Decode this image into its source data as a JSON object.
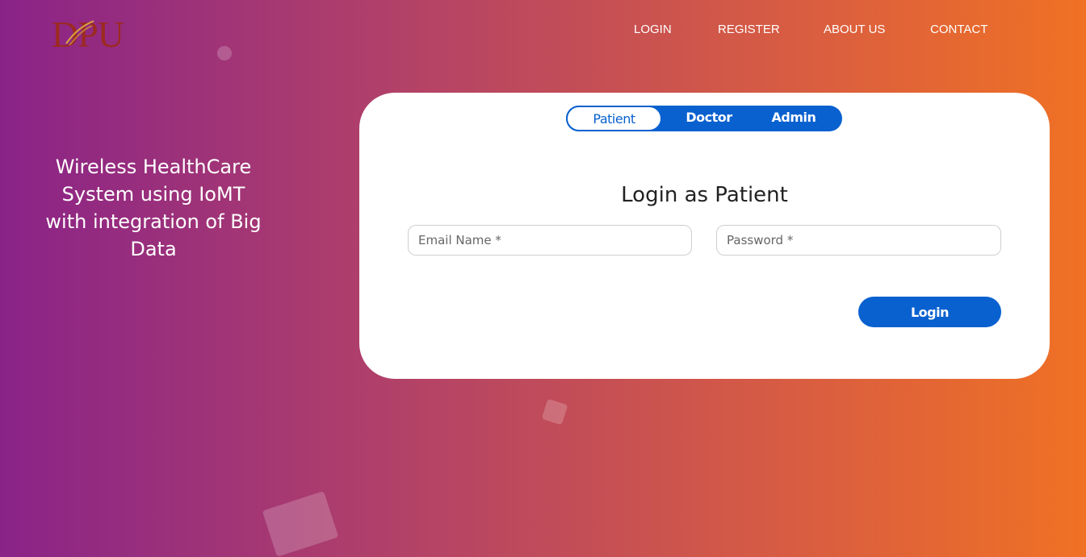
{
  "brand": {
    "logo_text": "DPU"
  },
  "nav": {
    "items": [
      {
        "label": "LOGIN"
      },
      {
        "label": "REGISTER"
      },
      {
        "label": "ABOUT US"
      },
      {
        "label": "CONTACT"
      }
    ]
  },
  "hero": {
    "tagline": "Wireless HealthCare System using IoMT with integration of Big Data"
  },
  "login_card": {
    "roles": [
      {
        "label": "Patient",
        "active": true
      },
      {
        "label": "Doctor",
        "active": false
      },
      {
        "label": "Admin",
        "active": false
      }
    ],
    "title": "Login as Patient",
    "email_placeholder": "Email Name *",
    "password_placeholder": "Password *",
    "submit_label": "Login"
  },
  "colors": {
    "gradient_start": "#8a2388",
    "gradient_end": "#f07124",
    "accent_blue": "#0861cf",
    "logo_red": "#9b2a22"
  }
}
